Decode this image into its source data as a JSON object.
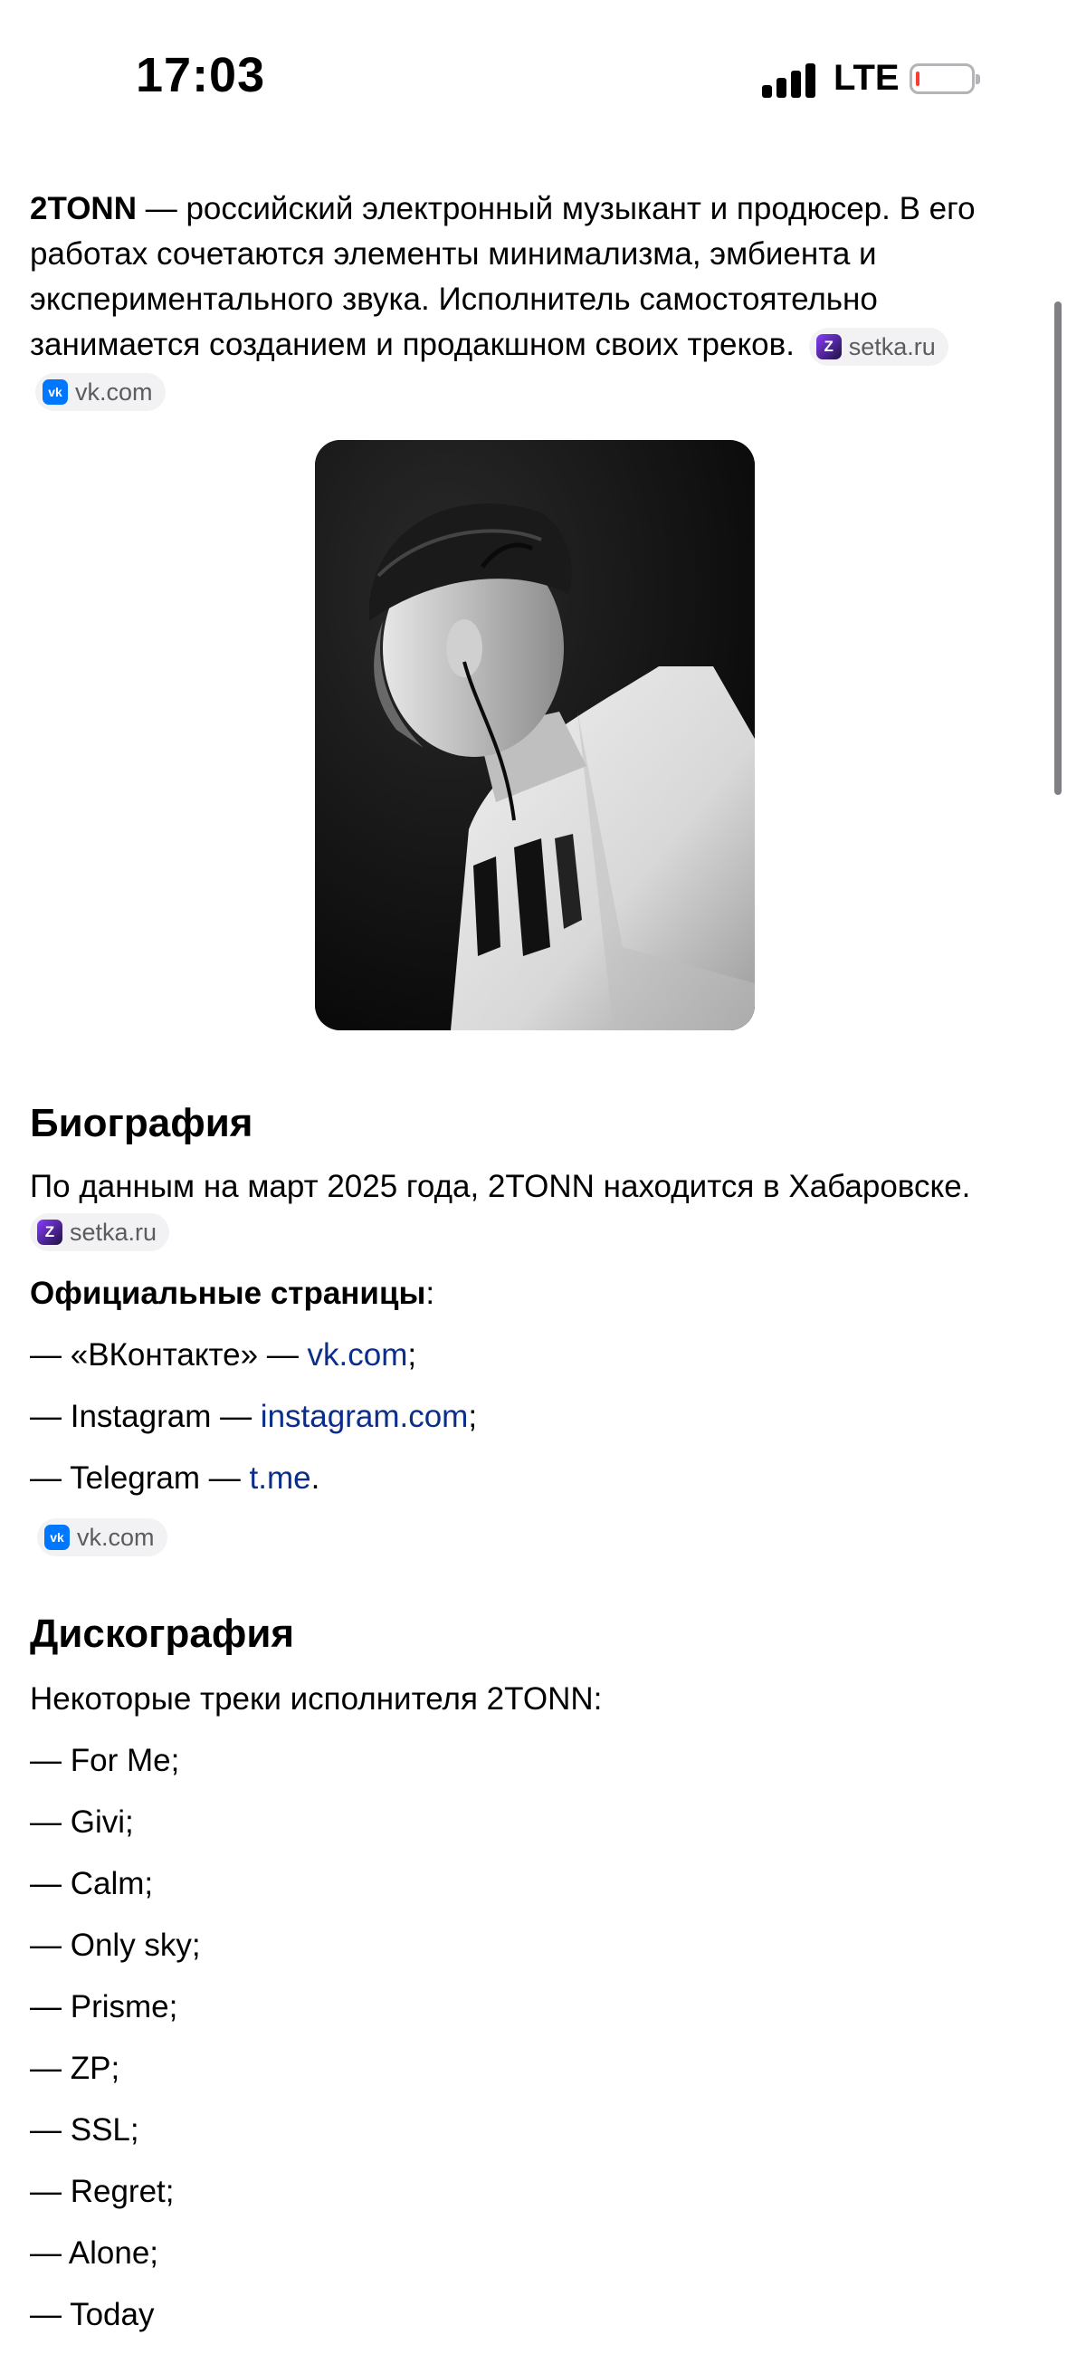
{
  "status_bar": {
    "time": "17:03",
    "network": "LTE"
  },
  "intro": {
    "name": "2TONN",
    "text": " — российский электронный музыкант и продюсер. В его работах сочетаются элементы минимализма, эмбиента и экспериментального звука. Исполнитель самостоятельно занимается созданием и продакшном своих треков.",
    "source1": "setka.ru",
    "source2": "vk.com"
  },
  "biography": {
    "title": "Биография",
    "text": "По данным на март 2025 года, 2TONN находится в Хабаровске.",
    "source": "setka.ru",
    "official_label": "Официальные страницы",
    "official_colon": ":",
    "pages": [
      {
        "prefix": "— «ВКонтакте» — ",
        "link": "vk.com",
        "suffix": ";"
      },
      {
        "prefix": "— Instagram — ",
        "link": "instagram.com",
        "suffix": ";"
      },
      {
        "prefix": "— Telegram — ",
        "link": "t.me",
        "suffix": "."
      }
    ],
    "pages_source": "vk.com"
  },
  "discography": {
    "title": "Дискография",
    "intro": "Некоторые треки исполнителя 2TONN:",
    "tracks": [
      "— For Me;",
      "— Givi;",
      "— Calm;",
      "— Only sky;",
      "— Prisme;",
      "— ZP;",
      "— SSL;",
      "— Regret;",
      "— Alone;",
      "— Today"
    ]
  }
}
